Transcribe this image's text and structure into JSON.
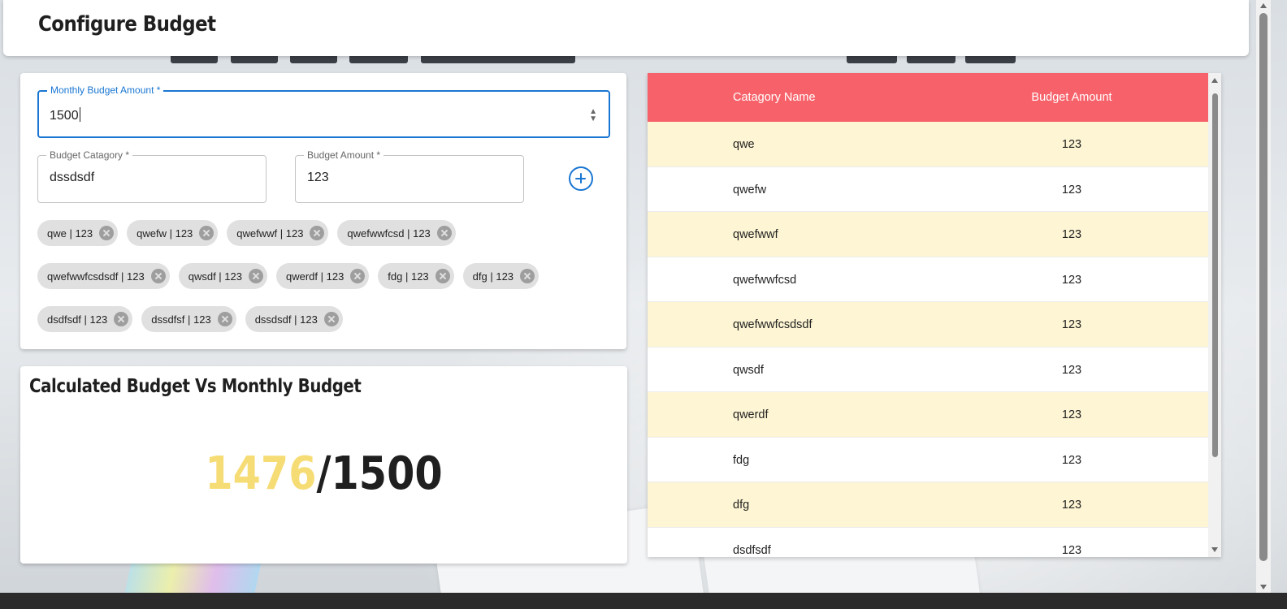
{
  "header": {
    "title": "Configure Budget"
  },
  "form": {
    "monthly_budget": {
      "label": "Monthly Budget Amount *",
      "value": "1500"
    },
    "budget_category": {
      "label": "Budget Catagory *",
      "value": "dssdsdf"
    },
    "budget_amount": {
      "label": "Budget Amount *",
      "value": "123"
    },
    "add_button_icon": "add-circle-icon",
    "chips": [
      [
        "qwe | 123",
        "qwefw | 123",
        "qwefwwf | 123",
        "qwefwwfcsd | 123"
      ],
      [
        "qwefwwfcsdsdf | 123",
        "qwsdf | 123",
        "qwerdf | 123",
        "fdg | 123",
        "dfg | 123"
      ],
      [
        "dsdfsdf | 123",
        "dssdfsf | 123",
        "dssdsdf | 123"
      ]
    ]
  },
  "summary": {
    "title": "Calculated Budget Vs Monthly Budget",
    "calculated": "1476",
    "separator": "/",
    "monthly": "1500"
  },
  "table": {
    "columns": [
      "Catagory Name",
      "Budget Amount"
    ],
    "rows": [
      [
        "qwe",
        "123"
      ],
      [
        "qwefw",
        "123"
      ],
      [
        "qwefwwf",
        "123"
      ],
      [
        "qwefwwfcsd",
        "123"
      ],
      [
        "qwefwwfcsdsdf",
        "123"
      ],
      [
        "qwsdf",
        "123"
      ],
      [
        "qwerdf",
        "123"
      ],
      [
        "fdg",
        "123"
      ],
      [
        "dfg",
        "123"
      ],
      [
        "dsdfsdf",
        "123"
      ]
    ]
  },
  "colors": {
    "header_row": "#f7626a",
    "striped_row": "#fdf5d3",
    "accent": "#1976d2",
    "calculated": "#f6dc75"
  }
}
